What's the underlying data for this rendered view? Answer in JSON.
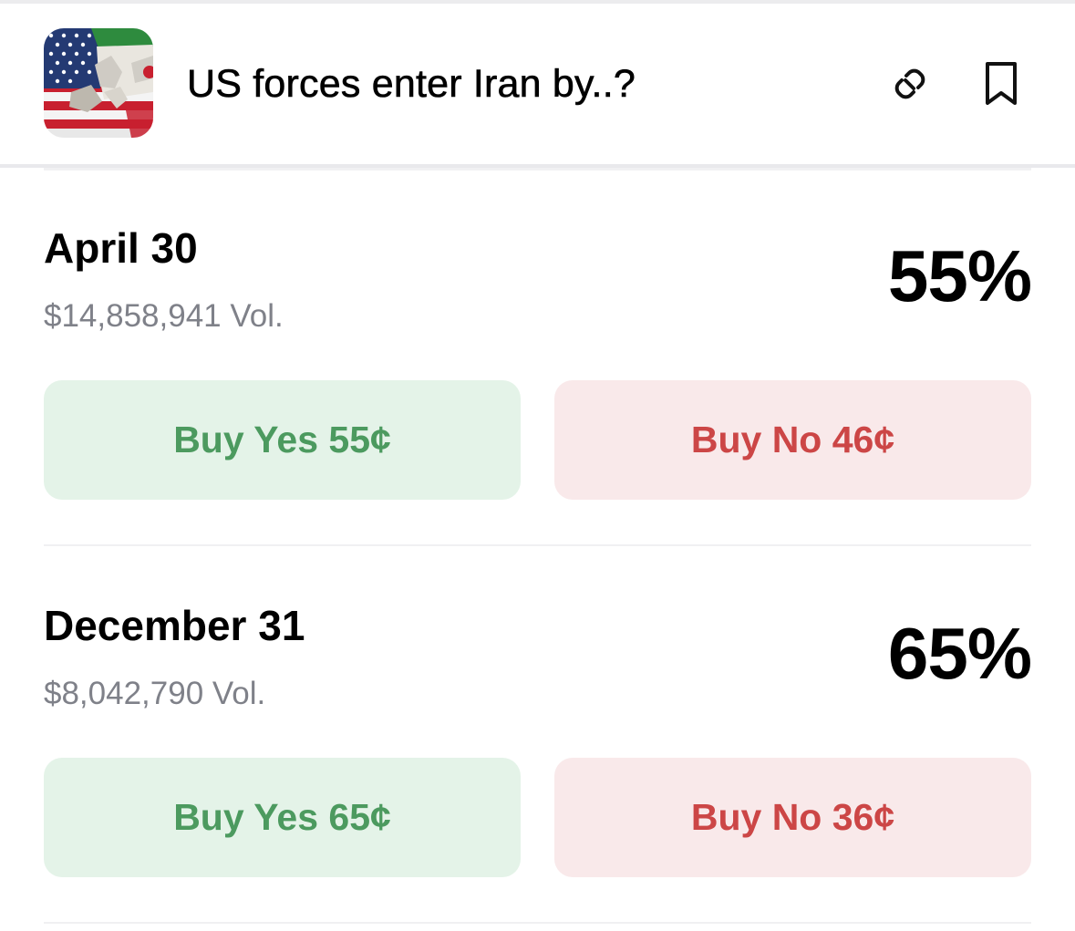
{
  "header": {
    "title": "US forces enter Iran by..?",
    "thumbnail_icon": "us-iran-flags-image",
    "link_icon": "link-icon",
    "bookmark_icon": "bookmark-icon"
  },
  "colors": {
    "yes_bg": "#e4f3e8",
    "yes_text": "#4c9a5f",
    "no_bg": "#f9e9ea",
    "no_text": "#cc4646",
    "muted_text": "#7f8189"
  },
  "markets": [
    {
      "name": "April 30",
      "volume": "$14,858,941 Vol.",
      "probability": "55%",
      "buy_yes": "Buy Yes 55¢",
      "buy_no": "Buy No 46¢"
    },
    {
      "name": "December 31",
      "volume": "$8,042,790 Vol.",
      "probability": "65%",
      "buy_yes": "Buy Yes 65¢",
      "buy_no": "Buy No 36¢"
    }
  ]
}
